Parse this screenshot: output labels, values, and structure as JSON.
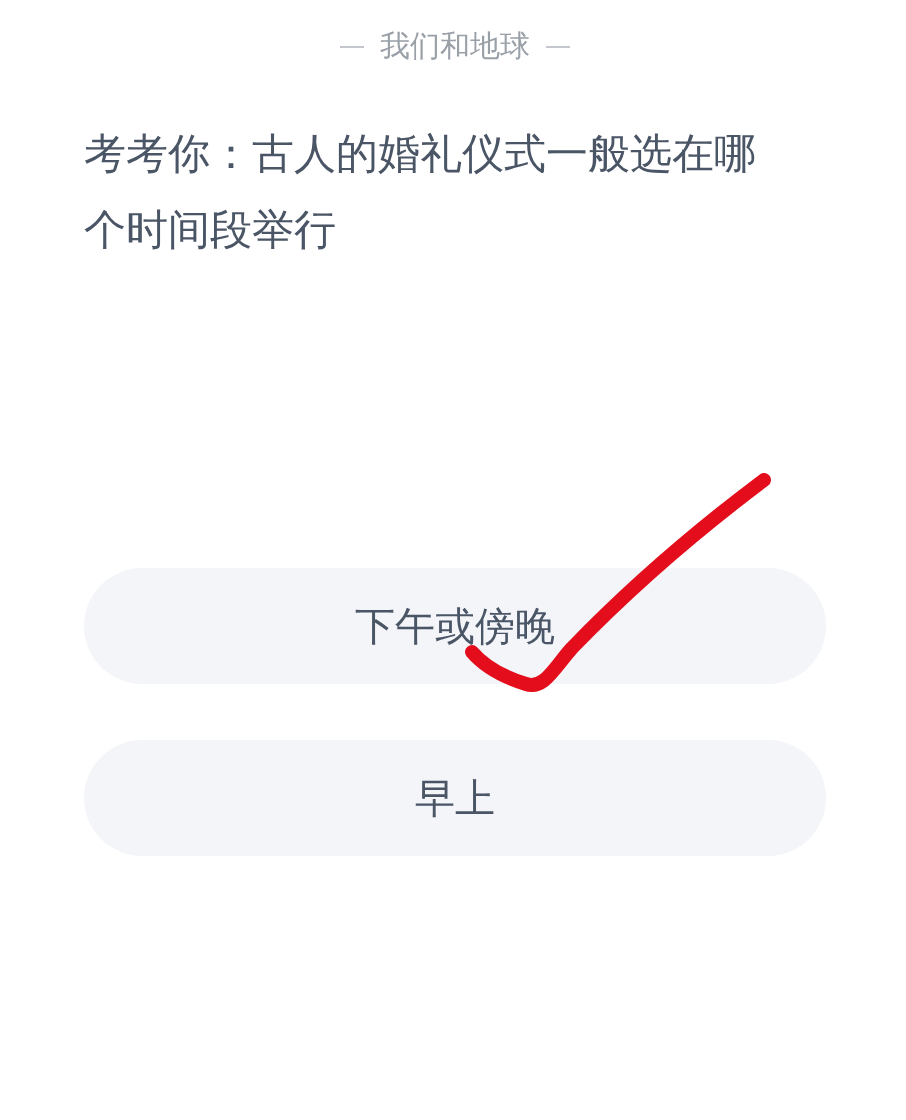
{
  "header": {
    "title": "我们和地球"
  },
  "question": "考考你：古人的婚礼仪式一般选在哪个时间段举行",
  "options": [
    {
      "label": "下午或傍晚",
      "marked": true
    },
    {
      "label": "早上",
      "marked": false
    }
  ]
}
